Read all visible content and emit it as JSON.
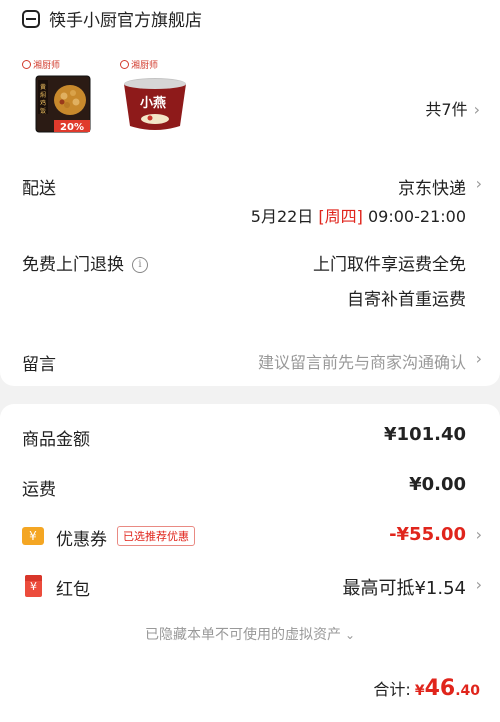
{
  "store": {
    "name": "筷手小厨官方旗舰店"
  },
  "products": [
    {
      "brand": "湘厨师",
      "title": "黄焖鸡饭",
      "badge": "20%"
    },
    {
      "brand": "湘厨师",
      "title": "小燕饭"
    }
  ],
  "items_count": "共7件",
  "delivery": {
    "label": "配送",
    "carrier": "京东快递",
    "date": "5月22日",
    "weekday": "[周四]",
    "time": "09:00-21:00"
  },
  "returns": {
    "label": "免费上门退换",
    "line1": "上门取件享运费全免",
    "line2": "自寄补首重运费"
  },
  "remark": {
    "label": "留言",
    "placeholder": "建议留言前先与商家沟通确认"
  },
  "summary": {
    "goods_label": "商品金额",
    "goods_value": "¥101.40",
    "shipping_label": "运费",
    "shipping_value": "¥0.00",
    "coupon_label": "优惠券",
    "coupon_tag": "已选推荐优惠",
    "coupon_value": "-¥55.00",
    "redpacket_label": "红包",
    "redpacket_value": "最高可抵¥1.54",
    "hidden_note": "已隐藏本单不可使用的虚拟资产",
    "total_label": "合计:",
    "total_currency": "¥",
    "total_int": "46",
    "total_dec": ".40"
  },
  "icons": {
    "coupon": "yen-coupon-icon",
    "redpacket": "red-envelope-icon",
    "store": "store-icon",
    "info": "info-icon",
    "chevron": "chevron-right-icon",
    "chevron_down": "chevron-down-icon"
  },
  "colors": {
    "accent_red": "#e0251c",
    "coupon_orange": "#f4a623",
    "muted": "#999999"
  }
}
